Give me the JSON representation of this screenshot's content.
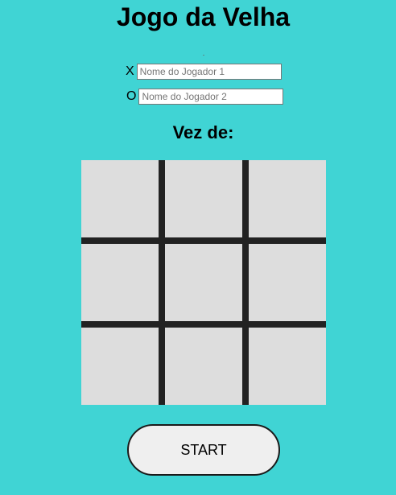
{
  "title": "Jogo da Velha",
  "players": [
    {
      "symbol": "X",
      "placeholder": "Nome do Jogador 1",
      "value": ""
    },
    {
      "symbol": "O",
      "placeholder": "Nome do Jogador 2",
      "value": ""
    }
  ],
  "turn": {
    "label": "Vez de:",
    "current_player": ""
  },
  "board": {
    "cells": [
      "",
      "",
      "",
      "",
      "",
      "",
      "",
      "",
      ""
    ]
  },
  "start_button_label": "START",
  "colors": {
    "background": "#40d4d4",
    "cell": "#dddddd",
    "grid_line": "#222222",
    "button": "#efefef"
  }
}
